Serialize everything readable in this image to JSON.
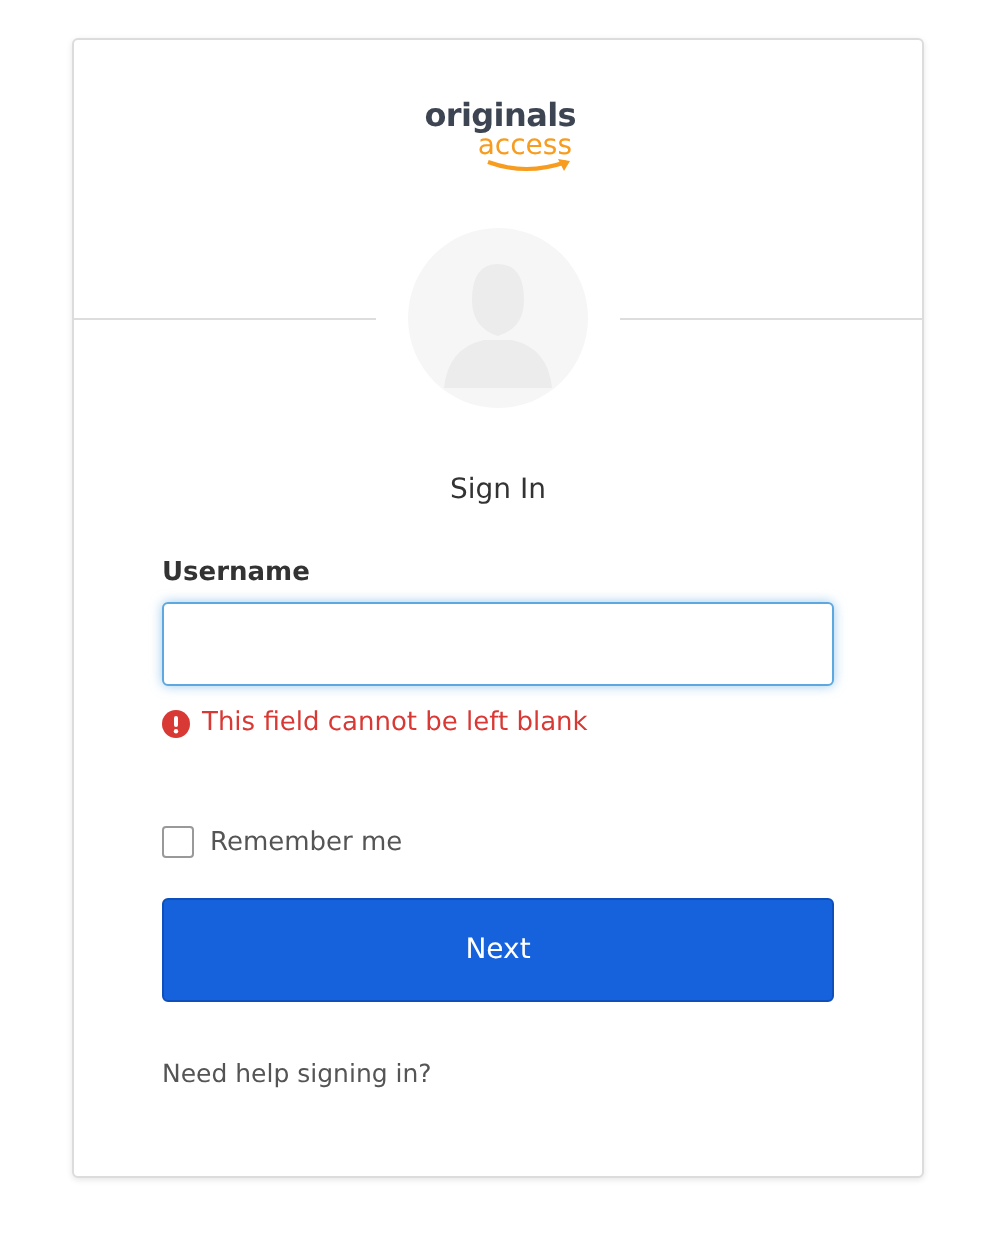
{
  "logo": {
    "line_1": "originals",
    "line_2": "access"
  },
  "title": "Sign In",
  "username": {
    "label": "Username",
    "error": "This field cannot be left blank",
    "focused": true
  },
  "remember_me": {
    "label": "Remember me",
    "checked": false
  },
  "next_button": "Next",
  "help_link": "Need help signing in?"
}
